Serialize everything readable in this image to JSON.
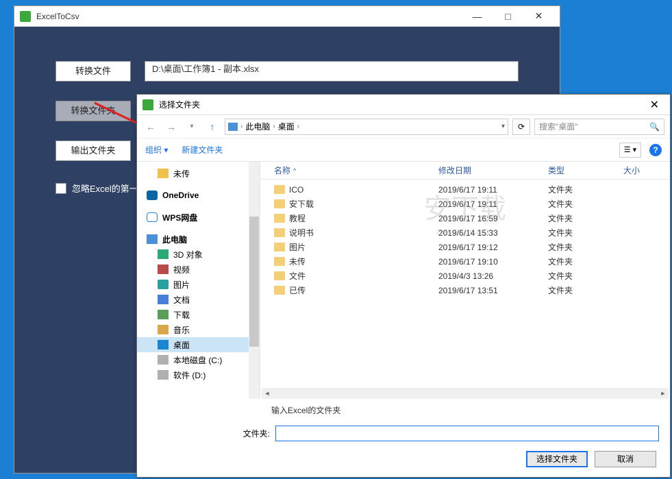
{
  "main": {
    "title": "ExcelToCsv",
    "convert_file_btn": "转换文件",
    "convert_folder_btn": "转换文件夹",
    "output_folder_btn": "输出文件夹",
    "file_path": "D:\\桌面\\工作簿1 - 副本.xlsx",
    "ignore_first_row": "忽略Excel的第一行"
  },
  "dialog": {
    "title": "选择文件夹",
    "breadcrumb": {
      "pc": "此电脑",
      "desktop": "桌面"
    },
    "search_placeholder": "搜索\"桌面\"",
    "toolbar": {
      "organize": "组织",
      "new_folder": "新建文件夹"
    },
    "sidebar": [
      {
        "label": "未传",
        "icon": "folder",
        "indent": 1
      },
      {
        "label": "OneDrive",
        "icon": "onedrive",
        "indent": 0,
        "bold": true
      },
      {
        "label": "WPS网盘",
        "icon": "wps",
        "indent": 0,
        "bold": true
      },
      {
        "label": "此电脑",
        "icon": "pc",
        "indent": 0,
        "bold": true
      },
      {
        "label": "3D 对象",
        "icon": "cube",
        "indent": 1
      },
      {
        "label": "视频",
        "icon": "video",
        "indent": 1
      },
      {
        "label": "图片",
        "icon": "pic",
        "indent": 1
      },
      {
        "label": "文档",
        "icon": "doc",
        "indent": 1
      },
      {
        "label": "下载",
        "icon": "dl",
        "indent": 1
      },
      {
        "label": "音乐",
        "icon": "music",
        "indent": 1
      },
      {
        "label": "桌面",
        "icon": "desk",
        "indent": 1,
        "selected": true
      },
      {
        "label": "本地磁盘 (C:)",
        "icon": "disk",
        "indent": 1
      },
      {
        "label": "软件 (D:)",
        "icon": "disk",
        "indent": 1
      }
    ],
    "columns": {
      "name": "名称",
      "date": "修改日期",
      "type": "类型",
      "size": "大小"
    },
    "files": [
      {
        "name": "ICO",
        "date": "2019/6/17 19:11",
        "type": "文件夹"
      },
      {
        "name": "安下载",
        "date": "2019/6/17 19:11",
        "type": "文件夹"
      },
      {
        "name": "教程",
        "date": "2019/6/17 16:59",
        "type": "文件夹"
      },
      {
        "name": "说明书",
        "date": "2019/6/14 15:33",
        "type": "文件夹"
      },
      {
        "name": "图片",
        "date": "2019/6/17 19:12",
        "type": "文件夹"
      },
      {
        "name": "未传",
        "date": "2019/6/17 19:10",
        "type": "文件夹"
      },
      {
        "name": "文件",
        "date": "2019/4/3 13:26",
        "type": "文件夹"
      },
      {
        "name": "已传",
        "date": "2019/6/17 13:51",
        "type": "文件夹"
      }
    ],
    "hint": "输入Excel的文件夹",
    "folder_label": "文件夹:",
    "select_btn": "选择文件夹",
    "cancel_btn": "取消"
  },
  "watermark": {
    "main": "安下载",
    "sub": "anxz.com"
  }
}
